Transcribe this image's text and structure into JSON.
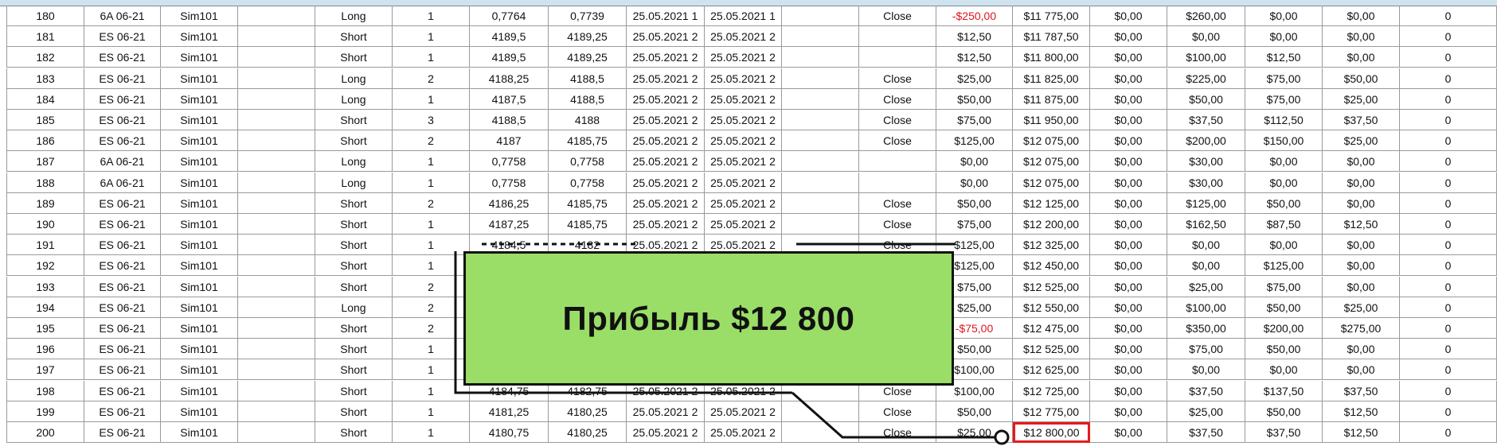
{
  "table": {
    "rows": [
      {
        "n": "180",
        "instrument": "6A 06-21",
        "account": "Sim101",
        "strategy": "",
        "direction": "Long",
        "qty": "1",
        "entry": "0,7764",
        "exit": "0,7739",
        "entry_time": "25.05.2021 1",
        "exit_time": "25.05.2021 1",
        "entry_name": "",
        "exit_name": "Close",
        "profit": "-$250,00",
        "cum_profit": "$11 775,00",
        "commission": "$0,00",
        "mae": "$260,00",
        "mfe": "$0,00",
        "etd": "$0,00",
        "bars": "0"
      },
      {
        "n": "181",
        "instrument": "ES 06-21",
        "account": "Sim101",
        "strategy": "",
        "direction": "Short",
        "qty": "1",
        "entry": "4189,5",
        "exit": "4189,25",
        "entry_time": "25.05.2021 2",
        "exit_time": "25.05.2021 2",
        "entry_name": "",
        "exit_name": "",
        "profit": "$12,50",
        "cum_profit": "$11 787,50",
        "commission": "$0,00",
        "mae": "$0,00",
        "mfe": "$0,00",
        "etd": "$0,00",
        "bars": "0"
      },
      {
        "n": "182",
        "instrument": "ES 06-21",
        "account": "Sim101",
        "strategy": "",
        "direction": "Short",
        "qty": "1",
        "entry": "4189,5",
        "exit": "4189,25",
        "entry_time": "25.05.2021 2",
        "exit_time": "25.05.2021 2",
        "entry_name": "",
        "exit_name": "",
        "profit": "$12,50",
        "cum_profit": "$11 800,00",
        "commission": "$0,00",
        "mae": "$100,00",
        "mfe": "$12,50",
        "etd": "$0,00",
        "bars": "0"
      },
      {
        "n": "183",
        "instrument": "ES 06-21",
        "account": "Sim101",
        "strategy": "",
        "direction": "Long",
        "qty": "2",
        "entry": "4188,25",
        "exit": "4188,5",
        "entry_time": "25.05.2021 2",
        "exit_time": "25.05.2021 2",
        "entry_name": "",
        "exit_name": "Close",
        "profit": "$25,00",
        "cum_profit": "$11 825,00",
        "commission": "$0,00",
        "mae": "$225,00",
        "mfe": "$75,00",
        "etd": "$50,00",
        "bars": "0"
      },
      {
        "n": "184",
        "instrument": "ES 06-21",
        "account": "Sim101",
        "strategy": "",
        "direction": "Long",
        "qty": "1",
        "entry": "4187,5",
        "exit": "4188,5",
        "entry_time": "25.05.2021 2",
        "exit_time": "25.05.2021 2",
        "entry_name": "",
        "exit_name": "Close",
        "profit": "$50,00",
        "cum_profit": "$11 875,00",
        "commission": "$0,00",
        "mae": "$50,00",
        "mfe": "$75,00",
        "etd": "$25,00",
        "bars": "0"
      },
      {
        "n": "185",
        "instrument": "ES 06-21",
        "account": "Sim101",
        "strategy": "",
        "direction": "Short",
        "qty": "3",
        "entry": "4188,5",
        "exit": "4188",
        "entry_time": "25.05.2021 2",
        "exit_time": "25.05.2021 2",
        "entry_name": "",
        "exit_name": "Close",
        "profit": "$75,00",
        "cum_profit": "$11 950,00",
        "commission": "$0,00",
        "mae": "$37,50",
        "mfe": "$112,50",
        "etd": "$37,50",
        "bars": "0"
      },
      {
        "n": "186",
        "instrument": "ES 06-21",
        "account": "Sim101",
        "strategy": "",
        "direction": "Short",
        "qty": "2",
        "entry": "4187",
        "exit": "4185,75",
        "entry_time": "25.05.2021 2",
        "exit_time": "25.05.2021 2",
        "entry_name": "",
        "exit_name": "Close",
        "profit": "$125,00",
        "cum_profit": "$12 075,00",
        "commission": "$0,00",
        "mae": "$200,00",
        "mfe": "$150,00",
        "etd": "$25,00",
        "bars": "0"
      },
      {
        "n": "187",
        "instrument": "6A 06-21",
        "account": "Sim101",
        "strategy": "",
        "direction": "Long",
        "qty": "1",
        "entry": "0,7758",
        "exit": "0,7758",
        "entry_time": "25.05.2021 2",
        "exit_time": "25.05.2021 2",
        "entry_name": "",
        "exit_name": "",
        "profit": "$0,00",
        "cum_profit": "$12 075,00",
        "commission": "$0,00",
        "mae": "$30,00",
        "mfe": "$0,00",
        "etd": "$0,00",
        "bars": "0"
      },
      {
        "n": "188",
        "instrument": "6A 06-21",
        "account": "Sim101",
        "strategy": "",
        "direction": "Long",
        "qty": "1",
        "entry": "0,7758",
        "exit": "0,7758",
        "entry_time": "25.05.2021 2",
        "exit_time": "25.05.2021 2",
        "entry_name": "",
        "exit_name": "",
        "profit": "$0,00",
        "cum_profit": "$12 075,00",
        "commission": "$0,00",
        "mae": "$30,00",
        "mfe": "$0,00",
        "etd": "$0,00",
        "bars": "0"
      },
      {
        "n": "189",
        "instrument": "ES 06-21",
        "account": "Sim101",
        "strategy": "",
        "direction": "Short",
        "qty": "2",
        "entry": "4186,25",
        "exit": "4185,75",
        "entry_time": "25.05.2021 2",
        "exit_time": "25.05.2021 2",
        "entry_name": "",
        "exit_name": "Close",
        "profit": "$50,00",
        "cum_profit": "$12 125,00",
        "commission": "$0,00",
        "mae": "$125,00",
        "mfe": "$50,00",
        "etd": "$0,00",
        "bars": "0"
      },
      {
        "n": "190",
        "instrument": "ES 06-21",
        "account": "Sim101",
        "strategy": "",
        "direction": "Short",
        "qty": "1",
        "entry": "4187,25",
        "exit": "4185,75",
        "entry_time": "25.05.2021 2",
        "exit_time": "25.05.2021 2",
        "entry_name": "",
        "exit_name": "Close",
        "profit": "$75,00",
        "cum_profit": "$12 200,00",
        "commission": "$0,00",
        "mae": "$162,50",
        "mfe": "$87,50",
        "etd": "$12,50",
        "bars": "0"
      },
      {
        "n": "191",
        "instrument": "ES 06-21",
        "account": "Sim101",
        "strategy": "",
        "direction": "Short",
        "qty": "1",
        "entry": "4184,5",
        "exit": "4182",
        "entry_time": "25.05.2021 2",
        "exit_time": "25.05.2021 2",
        "entry_name": "",
        "exit_name": "Close",
        "profit": "$125,00",
        "cum_profit": "$12 325,00",
        "commission": "$0,00",
        "mae": "$0,00",
        "mfe": "$0,00",
        "etd": "$0,00",
        "bars": "0"
      },
      {
        "n": "192",
        "instrument": "ES 06-21",
        "account": "Sim101",
        "strategy": "",
        "direction": "Short",
        "qty": "1",
        "entry": "",
        "exit": "",
        "entry_time": "",
        "exit_time": "",
        "entry_name": "",
        "exit_name": "",
        "profit": "$125,00",
        "cum_profit": "$12 450,00",
        "commission": "$0,00",
        "mae": "$0,00",
        "mfe": "$125,00",
        "etd": "$0,00",
        "bars": "0"
      },
      {
        "n": "193",
        "instrument": "ES 06-21",
        "account": "Sim101",
        "strategy": "",
        "direction": "Short",
        "qty": "2",
        "entry": "",
        "exit": "",
        "entry_time": "",
        "exit_time": "",
        "entry_name": "",
        "exit_name": "",
        "profit": "$75,00",
        "cum_profit": "$12 525,00",
        "commission": "$0,00",
        "mae": "$25,00",
        "mfe": "$75,00",
        "etd": "$0,00",
        "bars": "0"
      },
      {
        "n": "194",
        "instrument": "ES 06-21",
        "account": "Sim101",
        "strategy": "",
        "direction": "Long",
        "qty": "2",
        "entry": "",
        "exit": "",
        "entry_time": "",
        "exit_time": "",
        "entry_name": "",
        "exit_name": "",
        "profit": "$25,00",
        "cum_profit": "$12 550,00",
        "commission": "$0,00",
        "mae": "$100,00",
        "mfe": "$50,00",
        "etd": "$25,00",
        "bars": "0"
      },
      {
        "n": "195",
        "instrument": "ES 06-21",
        "account": "Sim101",
        "strategy": "",
        "direction": "Short",
        "qty": "2",
        "entry": "",
        "exit": "",
        "entry_time": "",
        "exit_time": "",
        "entry_name": "",
        "exit_name": "",
        "profit": "-$75,00",
        "cum_profit": "$12 475,00",
        "commission": "$0,00",
        "mae": "$350,00",
        "mfe": "$200,00",
        "etd": "$275,00",
        "bars": "0"
      },
      {
        "n": "196",
        "instrument": "ES 06-21",
        "account": "Sim101",
        "strategy": "",
        "direction": "Short",
        "qty": "1",
        "entry": "",
        "exit": "",
        "entry_time": "",
        "exit_time": "",
        "entry_name": "",
        "exit_name": "",
        "profit": "$50,00",
        "cum_profit": "$12 525,00",
        "commission": "$0,00",
        "mae": "$75,00",
        "mfe": "$50,00",
        "etd": "$0,00",
        "bars": "0"
      },
      {
        "n": "197",
        "instrument": "ES 06-21",
        "account": "Sim101",
        "strategy": "",
        "direction": "Short",
        "qty": "1",
        "entry": "",
        "exit": "",
        "entry_time": "",
        "exit_time": "",
        "entry_name": "",
        "exit_name": "",
        "profit": "$100,00",
        "cum_profit": "$12 625,00",
        "commission": "$0,00",
        "mae": "$0,00",
        "mfe": "$0,00",
        "etd": "$0,00",
        "bars": "0"
      },
      {
        "n": "198",
        "instrument": "ES 06-21",
        "account": "Sim101",
        "strategy": "",
        "direction": "Short",
        "qty": "1",
        "entry": "4184,75",
        "exit": "4182,75",
        "entry_time": "25.05.2021 2",
        "exit_time": "25.05.2021 2",
        "entry_name": "",
        "exit_name": "Close",
        "profit": "$100,00",
        "cum_profit": "$12 725,00",
        "commission": "$0,00",
        "mae": "$37,50",
        "mfe": "$137,50",
        "etd": "$37,50",
        "bars": "0"
      },
      {
        "n": "199",
        "instrument": "ES 06-21",
        "account": "Sim101",
        "strategy": "",
        "direction": "Short",
        "qty": "1",
        "entry": "4181,25",
        "exit": "4180,25",
        "entry_time": "25.05.2021 2",
        "exit_time": "25.05.2021 2",
        "entry_name": "",
        "exit_name": "Close",
        "profit": "$50,00",
        "cum_profit": "$12 775,00",
        "commission": "$0,00",
        "mae": "$25,00",
        "mfe": "$50,00",
        "etd": "$12,50",
        "bars": "0"
      },
      {
        "n": "200",
        "instrument": "ES 06-21",
        "account": "Sim101",
        "strategy": "",
        "direction": "Short",
        "qty": "1",
        "entry": "4180,75",
        "exit": "4180,25",
        "entry_time": "25.05.2021 2",
        "exit_time": "25.05.2021 2",
        "entry_name": "",
        "exit_name": "Close",
        "profit": "$25,00",
        "cum_profit": "$12 800,00",
        "commission": "$0,00",
        "mae": "$37,50",
        "mfe": "$37,50",
        "etd": "$12,50",
        "bars": "0"
      }
    ],
    "negative_color": "#e0141e",
    "highlight_color": "#e8191e"
  },
  "callout": {
    "text": "Прибыль $12 800",
    "background": "#9ade67"
  }
}
